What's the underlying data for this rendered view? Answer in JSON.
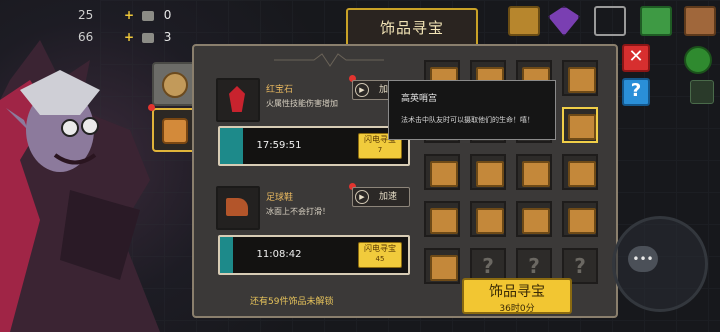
{
  "hud": {
    "row1_plus": "+",
    "row1_value": "0",
    "row2_plus": "+",
    "row2_value": "3",
    "left_num1": "25",
    "left_num2": "66"
  },
  "title": "饰品寻宝",
  "category_tabs": [
    "bag-category",
    "trinket-category"
  ],
  "items": [
    {
      "name": "红宝石",
      "desc": "火属性技能伤害增加",
      "speed_label": "加速",
      "timer": "17:59:51",
      "timer_progress": 0.12,
      "flash_label": "闪电寻宝",
      "flash_count": "7"
    },
    {
      "name": "足球鞋",
      "desc": "冰面上不会打滑！",
      "speed_label": "加速",
      "timer": "11:08:42",
      "timer_progress": 0.07,
      "flash_label": "闪电寻宝",
      "flash_count": "45"
    }
  ],
  "unlock_text": "还有59件饰品未解锁",
  "tooltip": {
    "title": "高英哨宫",
    "desc": "法术击中队友时可以摄取他们的生命！嘻！"
  },
  "big_button": {
    "label": "饰品寻宝",
    "sub": "36时0分"
  },
  "grid_selected_index": 7,
  "grid_locked_indices": [
    17,
    18,
    19
  ],
  "colors": {
    "accent_gold": "#f2c632",
    "timer_teal": "#1d8a8a",
    "close_red": "#d72f2f",
    "help_blue": "#2a8fd8"
  },
  "icons": {
    "close": "✕",
    "help": "?",
    "chat": "•••",
    "play": "▶"
  }
}
